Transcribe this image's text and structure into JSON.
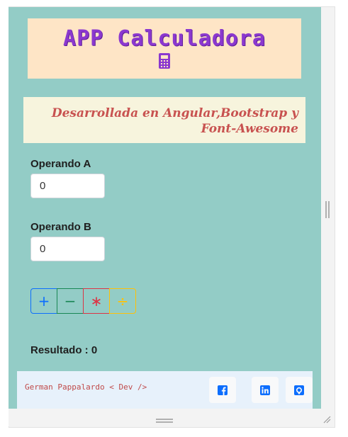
{
  "app": {
    "title": "APP Calculadora",
    "subtitle": "Desarrollada en Angular,Bootstrap y Font-Awesome"
  },
  "form": {
    "operand_a_label": "Operando A",
    "operand_a_value": "0",
    "operand_b_label": "Operando B",
    "operand_b_value": "0"
  },
  "operations": {
    "add": "+",
    "subtract": "−",
    "multiply": "∗",
    "divide": "÷"
  },
  "result": {
    "text": "Resultado : 0"
  },
  "footer": {
    "credit": "German Pappalardo < Dev />",
    "links": [
      {
        "icon": "facebook-icon"
      },
      {
        "icon": "linkedin-icon"
      },
      {
        "icon": "github-icon"
      }
    ]
  },
  "colors": {
    "background": "#93ccc6",
    "title_bg": "#fee5c6",
    "title_text": "#8b38cf",
    "subtitle_bg": "#f7f4dd",
    "subtitle_text": "#c85250",
    "footer_bg": "#e7f1fb",
    "footer_text": "#c04a4a",
    "add": "#0d6efd",
    "subtract": "#198754",
    "multiply": "#dc3545",
    "divide": "#ffc107",
    "social_icon": "#0d6efd"
  }
}
